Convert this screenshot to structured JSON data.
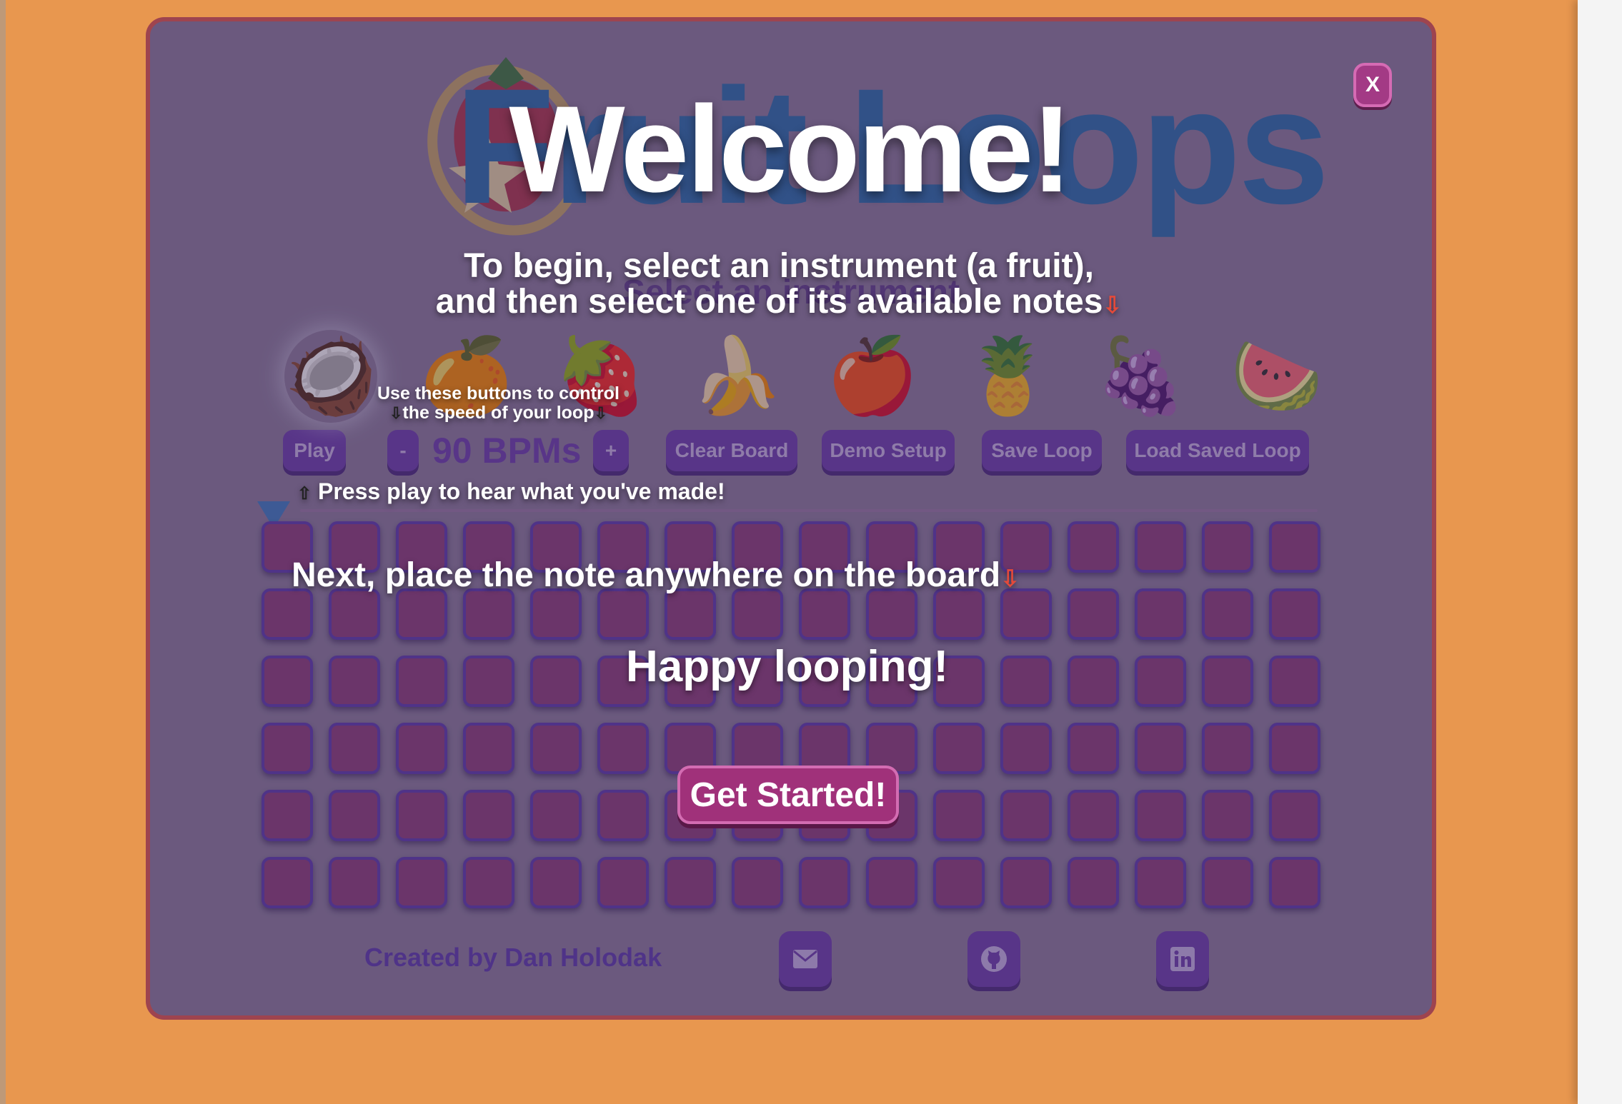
{
  "app": {
    "logo_text": "Fruit Loops",
    "subtitle": "Select an instrument",
    "fruits": [
      {
        "name": "coconut",
        "emoji": "🥥"
      },
      {
        "name": "orange",
        "emoji": "🍊"
      },
      {
        "name": "strawberry",
        "emoji": "🍓"
      },
      {
        "name": "banana",
        "emoji": "🍌"
      },
      {
        "name": "apple",
        "emoji": "🍎"
      },
      {
        "name": "pineapple",
        "emoji": "🍍"
      },
      {
        "name": "grapes",
        "emoji": "🍇"
      },
      {
        "name": "watermelon",
        "emoji": "🍉"
      }
    ],
    "controls": {
      "play": "Play",
      "minus": "-",
      "bpm": "90 BPMs",
      "plus": "+",
      "clear": "Clear Board",
      "demo": "Demo Setup",
      "save": "Save Loop",
      "load": "Load Saved Loop"
    },
    "grid": {
      "rows": 6,
      "cols": 16
    },
    "footer": {
      "credit": "Created by Dan Holodak",
      "icons": [
        "mail-icon",
        "github-icon",
        "linkedin-icon"
      ]
    }
  },
  "modal": {
    "title": "Welcome!",
    "close": "X",
    "instructions_line1": "To begin, select an instrument (a fruit),",
    "instructions_line2": "and then select one of its available notes",
    "bpm_hint_line1": "Use these buttons to control",
    "bpm_hint_line2": "the speed of your loop",
    "play_hint": "Press play to hear what you've made!",
    "board_hint": "Next, place the note anywhere on the board",
    "happy": "Happy looping!",
    "start_button": "Get Started!",
    "down_arrow": "⇩",
    "up_arrow": "⇧"
  },
  "colors": {
    "page_bg": "#e8974f",
    "frame_border": "#e5594f",
    "button": "#6d3fb0",
    "cell": "#8e3f7c",
    "logo": "#2a6fae",
    "start_button": "#a0317a"
  }
}
